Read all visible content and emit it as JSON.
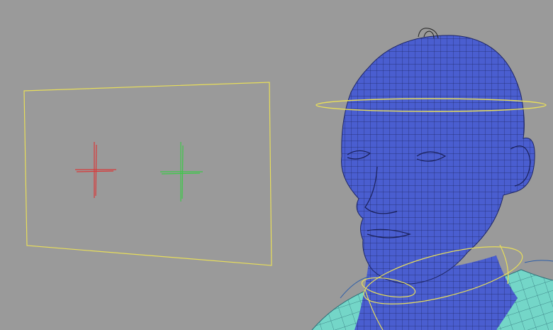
{
  "viewport": {
    "background": "#9a9a9a"
  },
  "scene": {
    "locator_plane": {
      "color": "#e8de5a"
    },
    "left_eye_locator": {
      "color": "#d83b3b"
    },
    "right_eye_locator": {
      "color": "#3fc84a"
    },
    "head_mesh": {
      "fill": "#4a5ed0",
      "wire": "#1f2766"
    },
    "shirt_mesh": {
      "fill": "#74d6c8",
      "wire": "#2e6f78"
    },
    "head_control_ring": {
      "color": "#e8de5a"
    },
    "neck_control_ring": {
      "color": "#e8de5a"
    },
    "hair_curve": {
      "color": "#222222"
    }
  }
}
